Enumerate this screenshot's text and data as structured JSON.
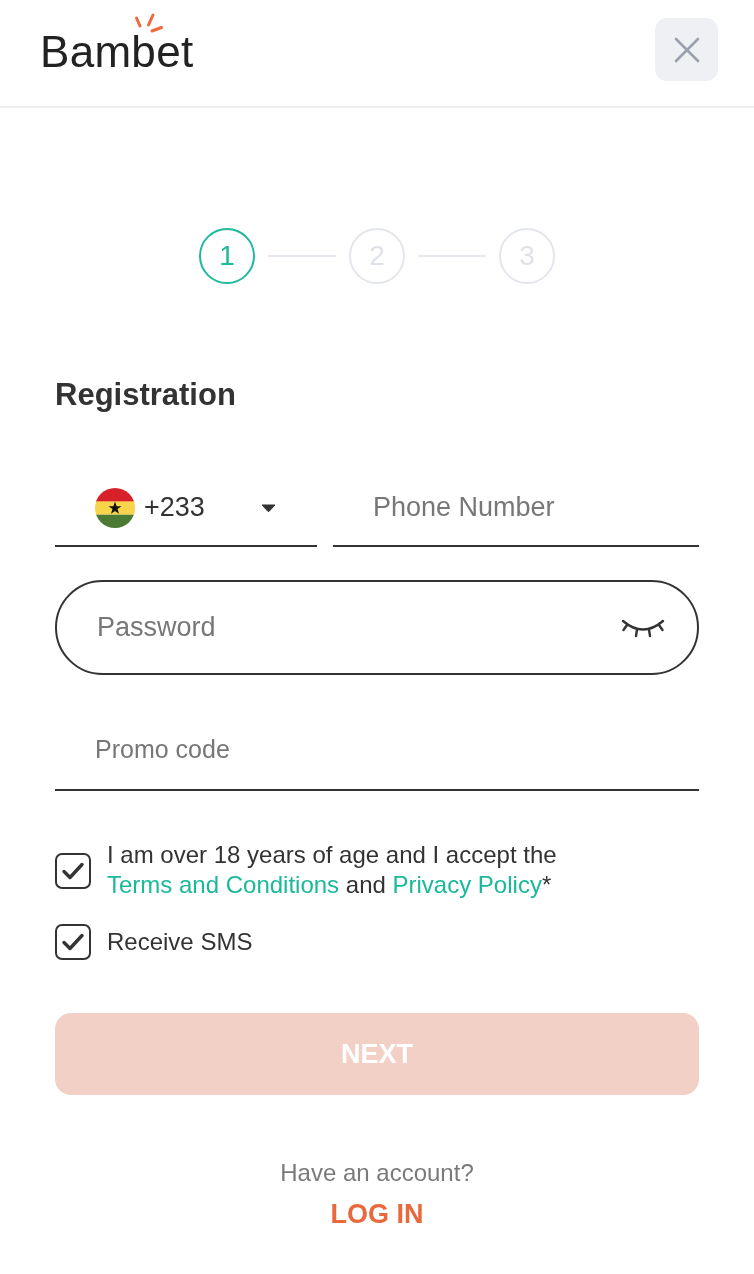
{
  "header": {
    "logo": "Bambet"
  },
  "stepper": {
    "steps": [
      {
        "label": "1",
        "selected": true
      },
      {
        "label": "2",
        "selected": false
      },
      {
        "label": "3",
        "selected": false
      }
    ]
  },
  "form": {
    "title": "Registration",
    "country_code": "+233",
    "phone_placeholder": "Phone Number",
    "password_placeholder": "Password",
    "promo_placeholder": "Promo code"
  },
  "checkboxes": [
    {
      "checked": true,
      "parts": [
        {
          "kind": "text",
          "text": "I am over 18 years of age and I accept the "
        },
        {
          "kind": "link",
          "text": "Terms and Conditions"
        },
        {
          "kind": "text",
          "text": " and "
        },
        {
          "kind": "link",
          "text": "Privacy Policy"
        },
        {
          "kind": "text",
          "text": "*"
        }
      ]
    },
    {
      "checked": true,
      "parts": [
        {
          "kind": "text",
          "text": "Receive SMS"
        }
      ]
    }
  ],
  "next_button": {
    "label": "NEXT",
    "disabled": true
  },
  "login": {
    "prompt": "Have an account?",
    "link": "LOG IN"
  }
}
